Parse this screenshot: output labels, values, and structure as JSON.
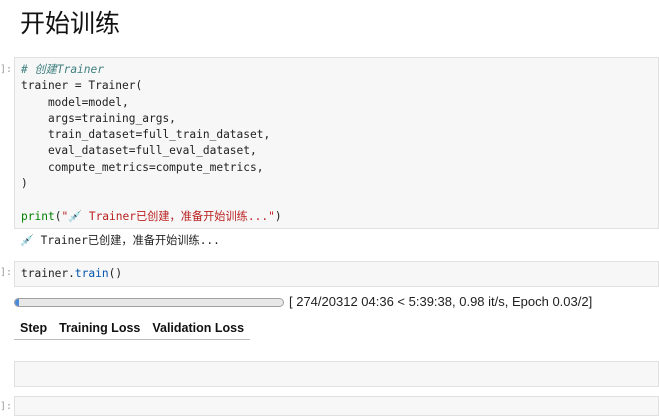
{
  "heading": "开始训练",
  "cell1": {
    "prompt": "]:",
    "comment": "# 创建Trainer",
    "lines": [
      "trainer = Trainer(",
      "    model=model,",
      "    args=training_args,",
      "    train_dataset=full_train_dataset,",
      "    eval_dataset=full_eval_dataset,",
      "    compute_metrics=compute_metrics,",
      ")"
    ],
    "print_fn": "print",
    "print_open": "(",
    "print_str": "\"💉 Trainer已创建，准备开始训练...\"",
    "print_close": ")"
  },
  "output1": "💉 Trainer已创建，准备开始训练...",
  "cell2": {
    "prompt": "]:",
    "obj": "trainer.",
    "method": "train",
    "args": "()"
  },
  "progress": {
    "fraction": 0.0135,
    "text": "[ 274/20312 04:36 < 5:39:38, 0.98 it/s, Epoch 0.03/2]",
    "fill_color": "#4a8ad6"
  },
  "metrics_table": {
    "columns": [
      "Step",
      "Training Loss",
      "Validation Loss"
    ]
  },
  "cell3": {
    "prompt": ""
  },
  "cell4": {
    "prompt": "]:"
  }
}
